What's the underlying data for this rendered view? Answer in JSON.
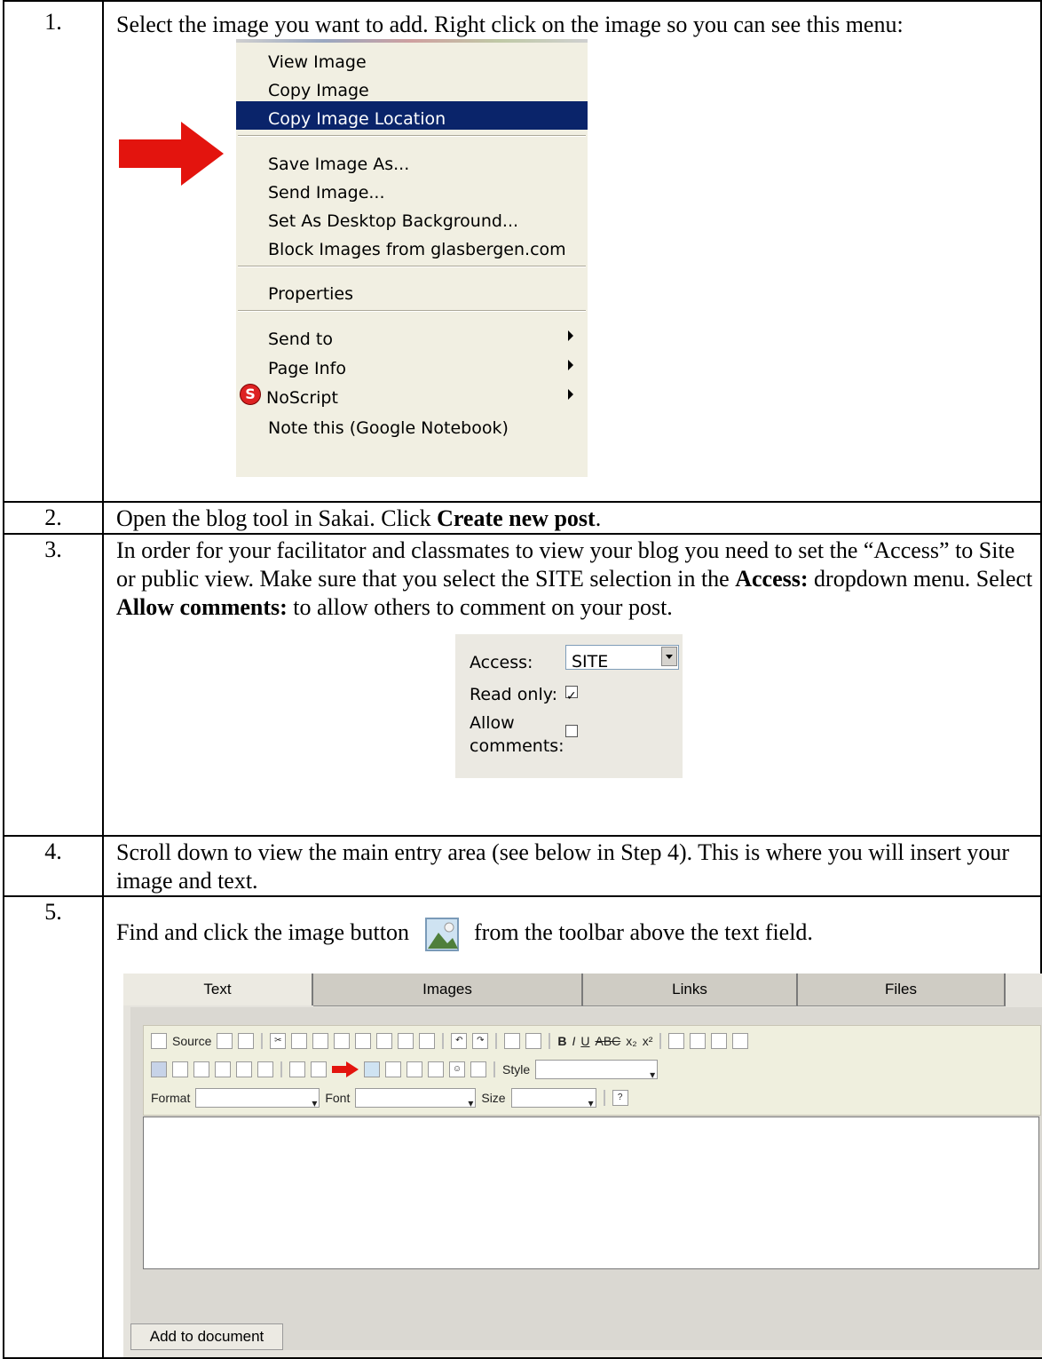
{
  "steps": [
    {
      "num": "1.",
      "text": "Select the image you want to add.  Right click on the image so you can see this menu:"
    },
    {
      "num": "2.",
      "text_pre": "Open the blog tool in Sakai. Click ",
      "text_bold": "Create new post",
      "text_post": "."
    },
    {
      "num": "3.",
      "p1": "In order for your facilitator and classmates to view your blog you need to set the “Access” to Site or public view. Make sure that you select the SITE selection in the ",
      "b1": "Access:",
      "p2": " dropdown menu. Select  ",
      "b2": "Allow comments:",
      "p3": "  to allow others to comment on your post."
    },
    {
      "num": "4.",
      "text": "Scroll down to view the main entry area (see below in Step 4). This is where you will insert your image and text."
    },
    {
      "num": "5.",
      "pre": "Find and click the image button",
      "post": "from the toolbar above the text field."
    }
  ],
  "context_menu": {
    "items": [
      "View Image",
      "Copy Image",
      "Copy Image Location",
      "Save Image As...",
      "Send Image...",
      "Set As Desktop Background...",
      "Block Images from glasbergen.com",
      "Properties",
      "Send to",
      "Page Info",
      "NoScript",
      "Note this (Google Notebook)"
    ],
    "selected": "Copy Image Location"
  },
  "access_panel": {
    "access_label": "Access:",
    "access_value": "SITE",
    "read_only_label": "Read only:",
    "read_only_checked": true,
    "allow_label_1": "Allow",
    "allow_label_2": "comments:",
    "allow_checked": false
  },
  "editor": {
    "tabs": [
      "Text",
      "Images",
      "Links",
      "Files"
    ],
    "active_tab": "Text",
    "source_label": "Source",
    "style_label": "Style",
    "format_label": "Format",
    "font_label": "Font",
    "size_label": "Size",
    "add_button": "Add to document"
  }
}
